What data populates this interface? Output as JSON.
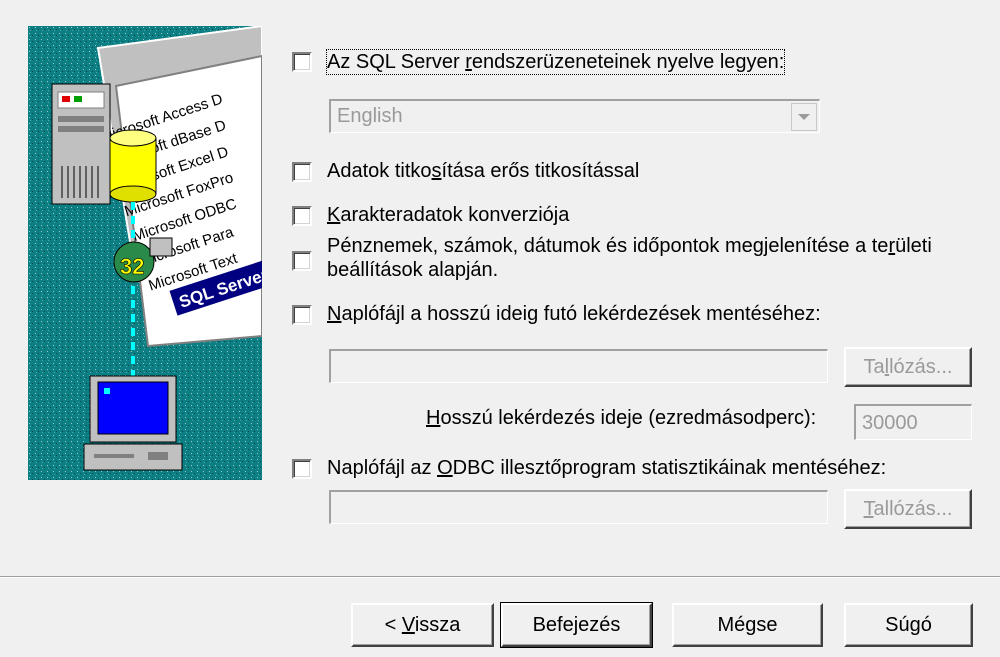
{
  "options": {
    "language": {
      "label_a": "Az SQL Server ",
      "label_u": "r",
      "label_b": "endszerüzeneteinek nyelve legyen:",
      "checked": false,
      "dropdown_value": "English"
    },
    "encryption": {
      "label_a": "Adatok titko",
      "label_u": "s",
      "label_b": "ítása erős titkosítással",
      "checked": false
    },
    "charconv": {
      "label_u": "K",
      "label_b": "arakteradatok konverziója",
      "checked": false
    },
    "regional": {
      "line1_a": "Pénznemek, számok, dátumok és időpontok megjelenítése a te",
      "line1_u": "r",
      "line1_b": "ületi",
      "line2": "beállítások alapján.",
      "checked": false
    },
    "longlog": {
      "label_u": "N",
      "label_b": "aplófájl a hosszú ideig futó lekérdezések mentéséhez:",
      "checked": false,
      "path_value": "",
      "browse_a": "Ta",
      "browse_u": "l",
      "browse_b": "lózás...",
      "time_label_u": "H",
      "time_label_b": "osszú lekérdezés ideje (ezredmásodperc):",
      "time_value": "30000"
    },
    "statslog": {
      "label_a": "Naplófájl az ",
      "label_u": "O",
      "label_b": "DBC illesztőprogram statisztikáinak mentéséhez:",
      "checked": false,
      "path_value": "",
      "browse_u": "T",
      "browse_b": "allózás..."
    }
  },
  "buttons": {
    "back_a": "< ",
    "back_u": "V",
    "back_b": "issza",
    "finish": "Befejezés",
    "cancel": "Mégse",
    "help": "Súgó"
  },
  "illustration": {
    "list_items": [
      "Microsoft Access D",
      "Microsoft dBase D",
      "Microsoft Excel D",
      "Microsoft FoxPro",
      "Microsoft ODBC",
      "Microsoft Para",
      "Microsoft Text",
      "SQL Server"
    ],
    "badge": "32"
  }
}
